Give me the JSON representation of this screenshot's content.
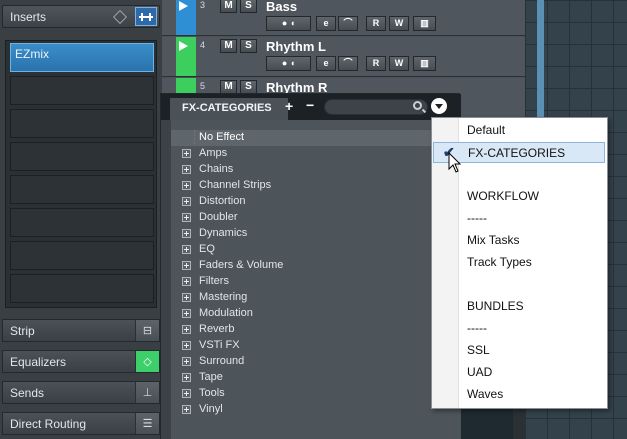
{
  "inspector": {
    "header_label": "Inserts",
    "slots": [
      {
        "label": "EZmix",
        "active": true
      },
      {
        "label": ""
      },
      {
        "label": ""
      },
      {
        "label": ""
      },
      {
        "label": ""
      },
      {
        "label": ""
      },
      {
        "label": ""
      },
      {
        "label": ""
      }
    ],
    "sections": [
      {
        "label": "Strip"
      },
      {
        "label": "Equalizers"
      },
      {
        "label": "Sends"
      },
      {
        "label": "Direct Routing"
      }
    ]
  },
  "tracks": [
    {
      "number": "3",
      "name": "Bass",
      "color": "#2f8fd4"
    },
    {
      "number": "4",
      "name": "Rhythm L",
      "color": "#3ccf5e"
    },
    {
      "number": "5",
      "name": "Rhythm R",
      "color": "#3ccf5e"
    }
  ],
  "track_buttons": {
    "mute": "M",
    "solo": "S",
    "edit": "e",
    "read": "R",
    "write": "W"
  },
  "fx_panel": {
    "tab_label": "FX-CATEGORIES",
    "add": "+",
    "remove": "−",
    "search_placeholder": "",
    "items": [
      "No Effect",
      "Amps",
      "Chains",
      "Channel Strips",
      "Distortion",
      "Doubler",
      "Dynamics",
      "EQ",
      "Faders & Volume",
      "Filters",
      "Mastering",
      "Modulation",
      "Reverb",
      "VSTi FX",
      "Surround",
      "Tape",
      "Tools",
      "Vinyl"
    ]
  },
  "dropdown": {
    "items": [
      "Default",
      "FX-CATEGORIES",
      "",
      "WORKFLOW",
      "-----",
      "Mix Tasks",
      "Track Types",
      "",
      "BUNDLES",
      "-----",
      "SSL",
      "UAD",
      "Waves"
    ],
    "selected_index": 1,
    "check": "✔"
  }
}
